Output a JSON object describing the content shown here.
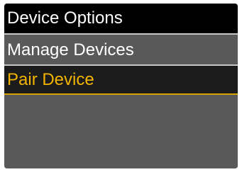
{
  "header": {
    "title": "Device Options"
  },
  "menu": {
    "items": [
      {
        "label": "Manage Devices",
        "selected": false
      },
      {
        "label": "Pair Device",
        "selected": true
      }
    ]
  },
  "colors": {
    "title_background": "#000000",
    "screen_background": "#595959",
    "text": "#ffffff",
    "selected_text": "#f2b400",
    "selected_background": "#1b1b1b",
    "divider": "#c7c7c7"
  }
}
